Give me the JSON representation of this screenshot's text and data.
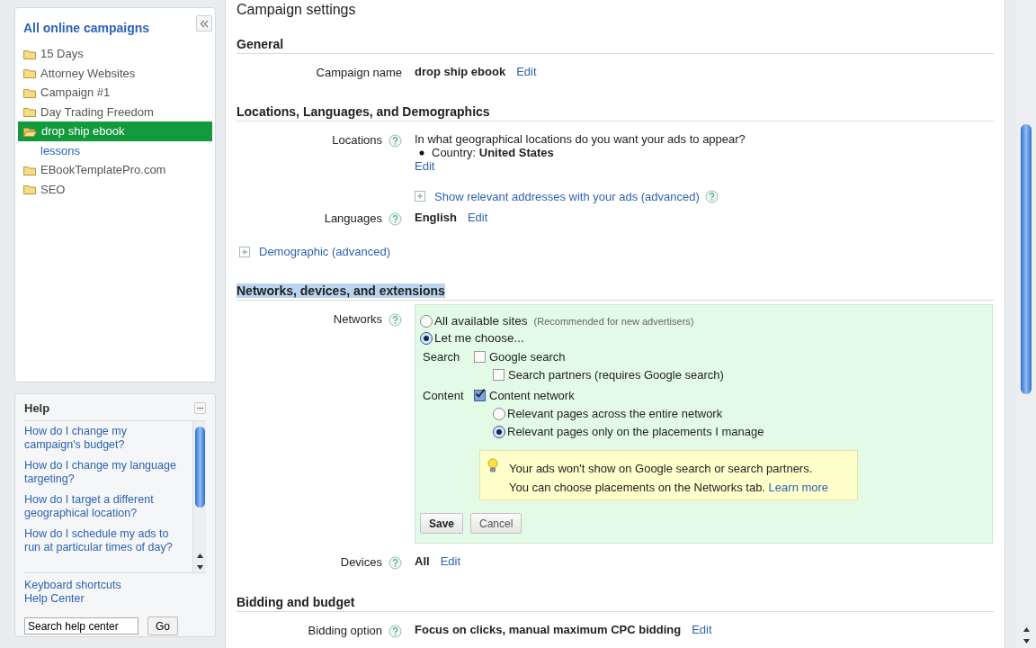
{
  "sidebar": {
    "title": "All online campaigns",
    "campaigns": [
      {
        "label": "15 Days",
        "selected": false,
        "expanded": false
      },
      {
        "label": "Attorney Websites",
        "selected": false,
        "expanded": false
      },
      {
        "label": "Campaign #1",
        "selected": false,
        "expanded": false
      },
      {
        "label": "Day Trading Freedom",
        "selected": false,
        "expanded": false
      },
      {
        "label": "drop ship ebook",
        "selected": true,
        "expanded": true,
        "children": [
          {
            "label": "lessons",
            "selected": false
          }
        ]
      },
      {
        "label": "EBookTemplatePro.com",
        "selected": false,
        "expanded": false
      },
      {
        "label": "SEO",
        "selected": false,
        "expanded": false
      }
    ]
  },
  "help": {
    "title": "Help",
    "links": [
      "How do I change my campaign's budget?",
      "How do I change my language targeting?",
      "How do I target a different geographical location?",
      "How do I schedule my ads to run at particular times of day?"
    ],
    "footer_links": [
      "Keyboard shortcuts",
      "Help Center"
    ],
    "search": {
      "value": "Search help center"
    },
    "go_button": "Go"
  },
  "main": {
    "title": "Campaign settings",
    "sections": [
      {
        "heading": "General",
        "highlighted": false,
        "items": [
          {
            "kind": "field",
            "label": "Campaign name",
            "help": false,
            "value": "drop ship ebook",
            "edit": "Edit"
          }
        ]
      },
      {
        "heading": "Locations, Languages, and Demographics",
        "highlighted": false,
        "items": [
          {
            "kind": "field",
            "label": "Locations",
            "help": true,
            "question": "In what geographical locations do you want your ads to appear?",
            "bullets": [
              "Country: **United States**"
            ],
            "edit": "Edit",
            "expander": {
              "label": "Show relevant addresses with your ads (advanced)",
              "help": true
            }
          },
          {
            "kind": "field",
            "label": "Languages",
            "help": true,
            "value": "English",
            "edit": "Edit"
          },
          {
            "kind": "expander",
            "label": "Demographic (advanced)",
            "help": false
          }
        ]
      },
      {
        "heading": "Networks, devices, and extensions",
        "highlighted": true,
        "items": [
          {
            "kind": "field",
            "label": "Networks",
            "help": true,
            "panel": {
              "modes": [
                {
                  "label": "All available sites",
                  "note": "(Recommended for new advertisers)",
                  "selected": false
                },
                {
                  "label": "Let me choose...",
                  "selected": true
                }
              ],
              "groups": [
                {
                  "label": "Search",
                  "checkbox": {
                    "label": "Google search",
                    "checked": false
                  },
                  "options": [
                    {
                      "kind": "checkbox",
                      "label": "Search partners (requires Google search)",
                      "checked": false
                    }
                  ]
                },
                {
                  "label": "Content",
                  "checkbox": {
                    "label": "Content network",
                    "checked": true
                  },
                  "options": [
                    {
                      "kind": "radio",
                      "label": "Relevant pages across the entire network",
                      "selected": false
                    },
                    {
                      "kind": "radio",
                      "label": "Relevant pages only on the placements I manage",
                      "selected": true
                    }
                  ]
                }
              ],
              "tip": {
                "lines": [
                  "Your ads won't show on Google search or search partners.",
                  "You can choose placements on the Networks tab."
                ],
                "link": "Learn more"
              },
              "buttons": [
                {
                  "label": "Save",
                  "kind": "primary"
                },
                {
                  "label": "Cancel",
                  "kind": "secondary"
                }
              ]
            }
          },
          {
            "kind": "field",
            "label": "Devices",
            "help": true,
            "value": "All",
            "edit": "Edit"
          }
        ]
      },
      {
        "heading": "Bidding and budget",
        "highlighted": false,
        "items": [
          {
            "kind": "field",
            "label": "Bidding option",
            "help": true,
            "value": "Focus on clicks, manual maximum CPC bidding",
            "edit": "Edit"
          }
        ]
      }
    ]
  }
}
